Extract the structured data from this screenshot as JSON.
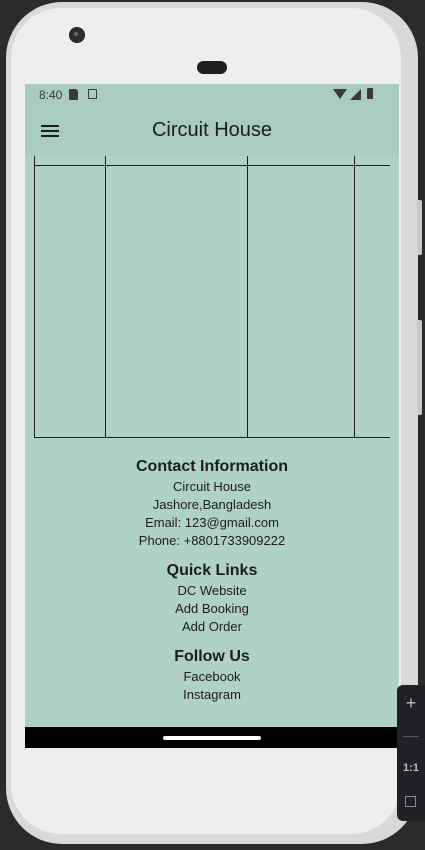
{
  "status_bar": {
    "time": "8:40"
  },
  "app_bar": {
    "title": "Circuit House"
  },
  "footer": {
    "contact": {
      "heading": "Contact Information",
      "lines": [
        "Circuit House",
        "Jashore,Bangladesh",
        "Email: 123@gmail.com",
        "Phone: +8801733909222"
      ]
    },
    "quick_links": {
      "heading": "Quick Links",
      "links": [
        "DC Website",
        "Add Booking",
        "Add Order"
      ]
    },
    "follow": {
      "heading": "Follow Us",
      "links": [
        "Facebook",
        "Instagram"
      ]
    }
  },
  "emulator_toolbar": {
    "zoom_label": "1:1"
  }
}
